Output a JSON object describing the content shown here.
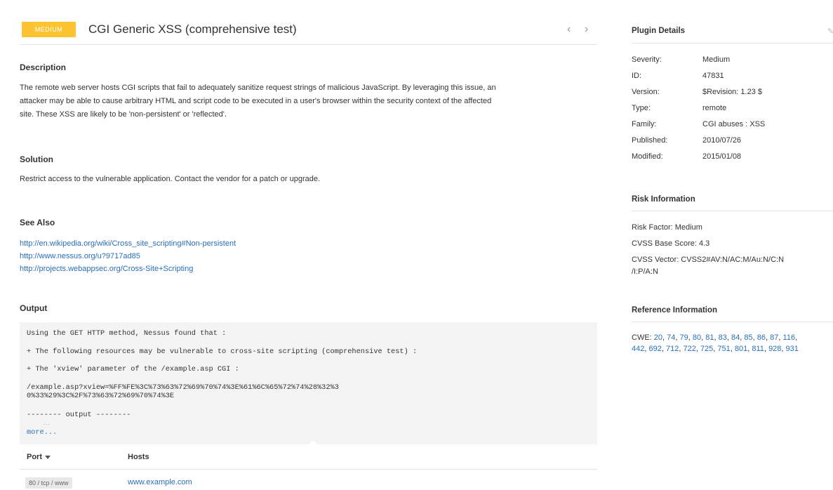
{
  "header": {
    "severity_badge": "MEDIUM",
    "title": "CGI Generic XSS (comprehensive test)",
    "prev": "‹",
    "next": "›"
  },
  "description": {
    "heading": "Description",
    "lines": [
      "The remote web server hosts CGI scripts that fail to adequately sanitize request strings of malicious JavaScript. By leveraging this issue, an",
      "attacker may be able to cause arbitrary HTML and script code to be executed in a user's browser within the security context of the affected",
      "site. These XSS are likely to be 'non-persistent' or 'reflected'."
    ]
  },
  "solution": {
    "heading": "Solution",
    "text": "Restrict access to the vulnerable application. Contact the vendor for a patch or upgrade."
  },
  "see_also": {
    "heading": "See Also",
    "links": [
      "http://en.wikipedia.org/wiki/Cross_site_scripting#Non-persistent",
      "http://www.nessus.org/u?9717ad85",
      "http://projects.webappsec.org/Cross-Site+Scripting"
    ]
  },
  "output": {
    "heading": "Output",
    "line1": "Using the GET HTTP method, Nessus found that :",
    "line2": "+ The following resources may be vulnerable to cross-site scripting (comprehensive test) :",
    "line3": "+ The 'xview' parameter of the /example.asp CGI :",
    "line4a": "/example.asp?xview=%FF%FE%3C%73%63%72%69%70%74%3E%61%6C%65%72%74%28%32%3",
    "line4b": "0%33%29%3C%2F%73%63%72%69%70%74%3E",
    "line5": "-------- output --------",
    "dots": "...",
    "more": "more..."
  },
  "table": {
    "port_header": "Port",
    "hosts_header": "Hosts",
    "rows": [
      {
        "port": "80 / tcp / www",
        "host": "www.example.com"
      }
    ]
  },
  "plugin_details": {
    "heading": "Plugin Details",
    "edit_icon": "pencil-icon",
    "rows": [
      {
        "k": "Severity:",
        "v": "Medium"
      },
      {
        "k": "ID:",
        "v": "47831"
      },
      {
        "k": "Version:",
        "v": "$Revision: 1.23 $"
      },
      {
        "k": "Type:",
        "v": "remote"
      },
      {
        "k": "Family:",
        "v": "CGI abuses : XSS"
      },
      {
        "k": "Published:",
        "v": "2010/07/26"
      },
      {
        "k": "Modified:",
        "v": "2015/01/08"
      }
    ]
  },
  "risk": {
    "heading": "Risk Information",
    "factor": "Risk Factor:  Medium",
    "cvss_score": "CVSS Base Score:  4.3",
    "cvss_vector_a": "CVSS Vector:  CVSS2#AV:N/AC:M/Au:N/C:N",
    "cvss_vector_b": "/I:P/A:N"
  },
  "reference": {
    "heading": "Reference Information",
    "cwe_label": "CWE:",
    "cwe_line1": [
      "20",
      "74",
      "79",
      "80",
      "81",
      "83",
      "84",
      "85",
      "86",
      "87",
      "116"
    ],
    "cwe_line2": [
      "442",
      "692",
      "712",
      "722",
      "725",
      "751",
      "801",
      "811",
      "928",
      "931"
    ]
  },
  "colors": {
    "badge": "#fdc431",
    "link": "#2a6ebb"
  }
}
